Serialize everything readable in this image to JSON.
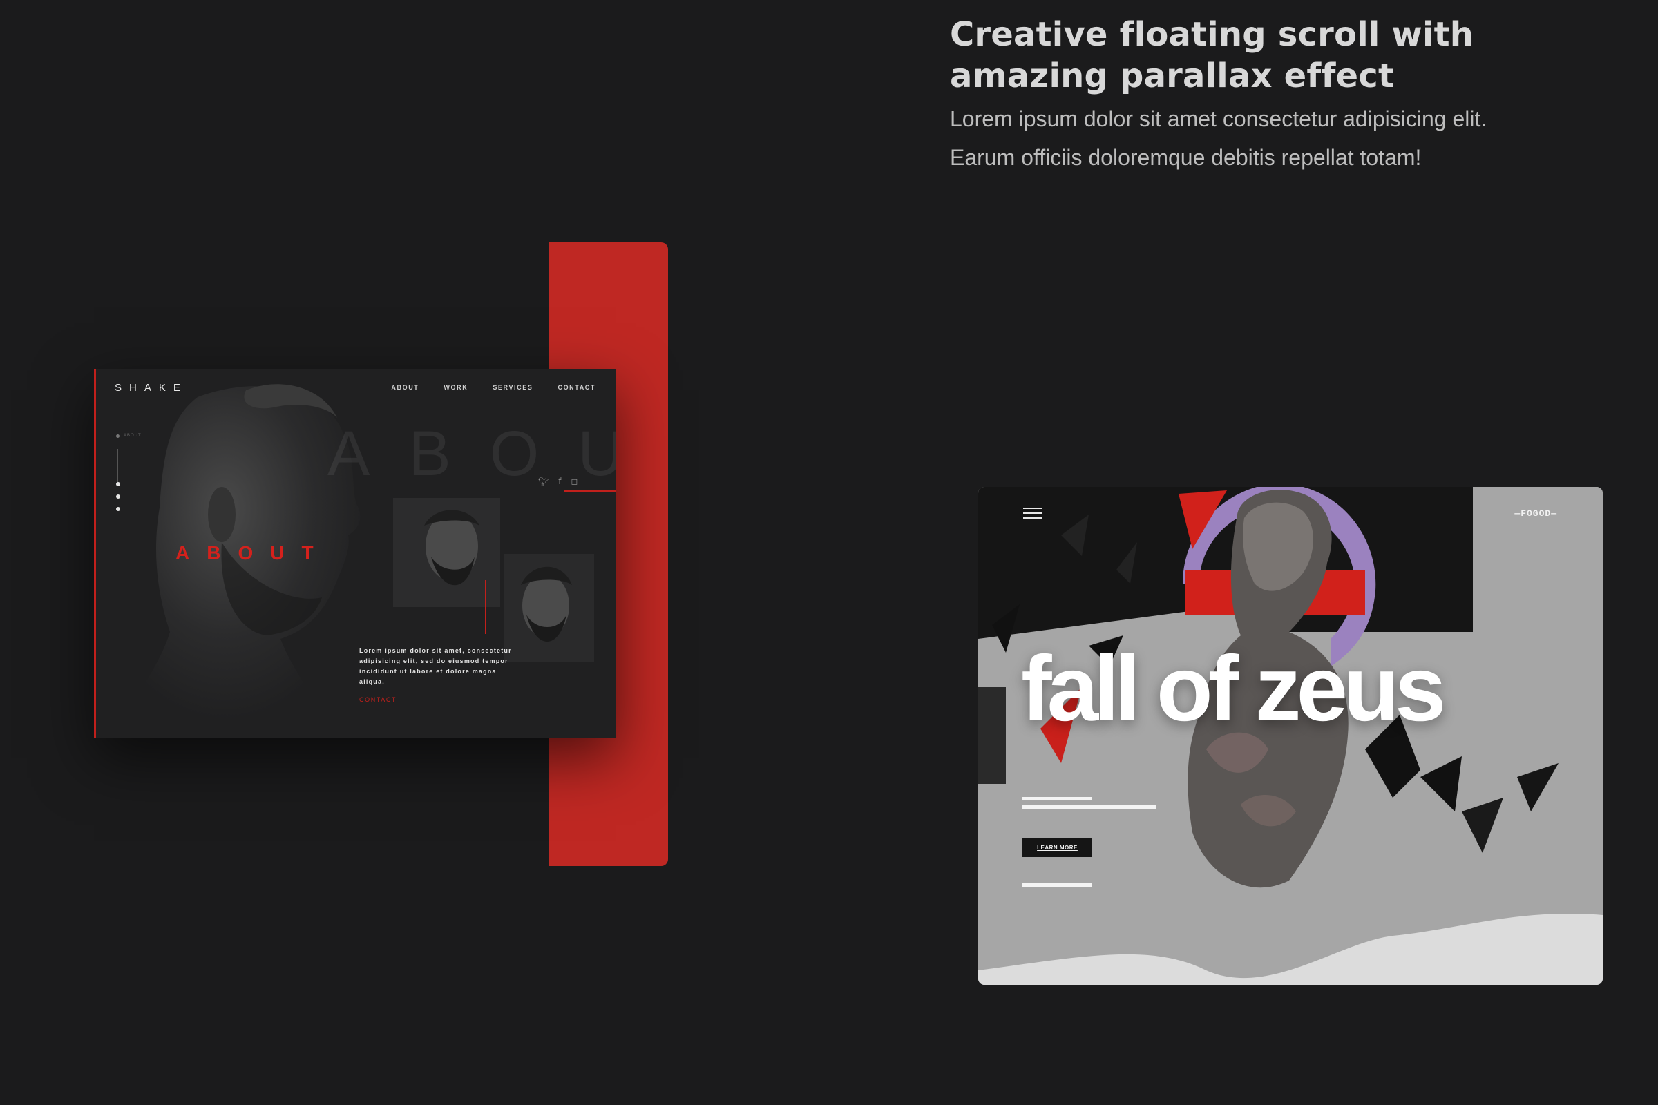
{
  "hero": {
    "title": "Creative floating scroll with amazing parallax effect",
    "desc_line1": "Lorem ipsum dolor sit amet consectetur adipisicing elit.",
    "desc_line2": "Earum officiis doloremque debitis repellat totam!"
  },
  "shake_mockup": {
    "logo": "SHAKE",
    "nav": [
      "ABOUT",
      "WORK",
      "SERVICES",
      "CONTACT"
    ],
    "ghost_heading": "ABOUT",
    "red_heading": "ABOUT",
    "side_label": "ABOUT",
    "socials": [
      "twitter-icon",
      "facebook-icon",
      "instagram-icon"
    ],
    "body_text": "Lorem ipsum dolor sit amet, consectetur adipisicing elit, sed do eiusmod tempor incididunt ut labore et dolore magna aliqua.",
    "contact_link": "CONTACT",
    "accent_color": "#c1201c"
  },
  "zeus_mockup": {
    "logo": "—FOGOD—",
    "title": "fall of zeus",
    "button_label": "LEARN MORE",
    "menu_icon": "hamburger-icon"
  }
}
